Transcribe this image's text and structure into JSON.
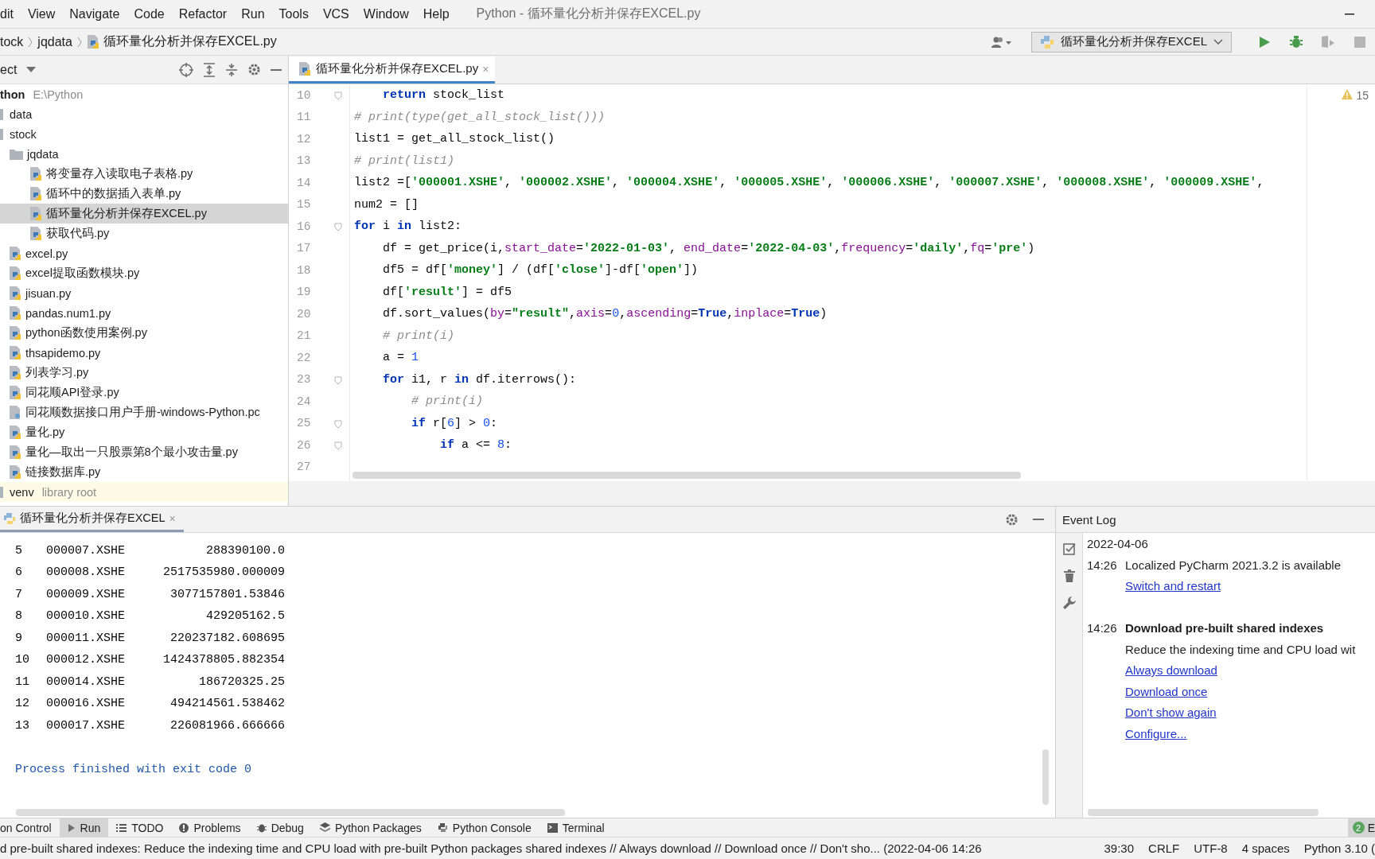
{
  "menu_items": [
    "dit",
    "View",
    "Navigate",
    "Code",
    "Refactor",
    "Run",
    "Tools",
    "VCS",
    "Window",
    "Help"
  ],
  "window": {
    "title": "Python - 循环量化分析并保存EXCEL.py"
  },
  "breadcrumbs": [
    {
      "label": "tock",
      "kind": "folder"
    },
    {
      "label": "jqdata",
      "kind": "folder"
    },
    {
      "label": "循环量化分析并保存EXCEL.py",
      "kind": "python"
    }
  ],
  "run_configuration": {
    "label": "循环量化分析并保存EXCEL"
  },
  "run_toolbar": [
    {
      "kind": "run",
      "disabled": false
    },
    {
      "kind": "debug",
      "disabled": false
    },
    {
      "kind": "coverage",
      "disabled": true
    },
    {
      "kind": "stop",
      "disabled": true
    }
  ],
  "project_panel": {
    "title": "ect",
    "tree": [
      {
        "label": "thon",
        "note": "E:\\Python",
        "kind": "root",
        "selected": false,
        "children": [
          {
            "label": "data",
            "kind": "folder",
            "selected": false
          },
          {
            "label": "stock",
            "kind": "folder",
            "selected": false,
            "children": [
              {
                "label": "jqdata",
                "kind": "folder",
                "selected": false,
                "children": [
                  {
                    "label": "将变量存入读取电子表格.py",
                    "kind": "python",
                    "selected": false
                  },
                  {
                    "label": "循环中的数据插入表单.py",
                    "kind": "python",
                    "selected": false
                  },
                  {
                    "label": "循环量化分析并保存EXCEL.py",
                    "kind": "python",
                    "selected": true
                  },
                  {
                    "label": "获取代码.py",
                    "kind": "python",
                    "selected": false
                  }
                ]
              },
              {
                "label": "excel.py",
                "kind": "python",
                "selected": false
              },
              {
                "label": "excel提取函数模块.py",
                "kind": "python",
                "selected": false
              },
              {
                "label": "jisuan.py",
                "kind": "python",
                "selected": false
              },
              {
                "label": "pandas.num1.py",
                "kind": "python",
                "selected": false
              },
              {
                "label": "python函数使用案例.py",
                "kind": "python",
                "selected": false
              },
              {
                "label": "thsapidemo.py",
                "kind": "python",
                "selected": false
              },
              {
                "label": "列表学习.py",
                "kind": "python",
                "selected": false
              },
              {
                "label": "同花顺API登录.py",
                "kind": "python",
                "selected": false
              },
              {
                "label": "同花顺数据接口用户手册-windows-Python.pc",
                "kind": "file",
                "selected": false
              },
              {
                "label": "量化.py",
                "kind": "python",
                "selected": false
              },
              {
                "label": "量化—取出一只股票第8个最小攻击量.py",
                "kind": "python",
                "selected": false
              },
              {
                "label": "链接数据库.py",
                "kind": "python",
                "selected": false
              }
            ]
          },
          {
            "label": "venv",
            "note": "library root",
            "kind": "folder",
            "selected": false
          }
        ]
      }
    ]
  },
  "editor": {
    "tabs": [
      {
        "label": "循环量化分析并保存EXCEL.py",
        "close": "×",
        "selected": true
      }
    ],
    "warnings": "15",
    "lines": [
      {
        "number": "10",
        "foldable": true,
        "tokens": [
          {
            "kind": "kw",
            "text": "    return"
          },
          {
            "kind": "plain",
            "text": " stock_list"
          }
        ]
      },
      {
        "number": "11",
        "foldable": false,
        "tokens": [
          {
            "kind": "cmt",
            "text": "# print(type(get_all_stock_list()))"
          }
        ]
      },
      {
        "number": "12",
        "foldable": false,
        "tokens": [
          {
            "kind": "plain",
            "text": "list1 = get_all_stock_list()"
          }
        ]
      },
      {
        "number": "13",
        "foldable": false,
        "tokens": [
          {
            "kind": "cmt",
            "text": "# print(list1)"
          }
        ]
      },
      {
        "number": "14",
        "foldable": false,
        "tokens": [
          {
            "kind": "plain",
            "text": "list2 =["
          },
          {
            "kind": "str",
            "text": "'000001.XSHE'"
          },
          {
            "kind": "plain",
            "text": ", "
          },
          {
            "kind": "str",
            "text": "'000002.XSHE'"
          },
          {
            "kind": "plain",
            "text": ", "
          },
          {
            "kind": "str",
            "text": "'000004.XSHE'"
          },
          {
            "kind": "plain",
            "text": ", "
          },
          {
            "kind": "str",
            "text": "'000005.XSHE'"
          },
          {
            "kind": "plain",
            "text": ", "
          },
          {
            "kind": "str",
            "text": "'000006.XSHE'"
          },
          {
            "kind": "plain",
            "text": ", "
          },
          {
            "kind": "str",
            "text": "'000007.XSHE'"
          },
          {
            "kind": "plain",
            "text": ", "
          },
          {
            "kind": "str",
            "text": "'000008.XSHE'"
          },
          {
            "kind": "plain",
            "text": ", "
          },
          {
            "kind": "str",
            "text": "'000009.XSHE'"
          },
          {
            "kind": "plain",
            "text": ","
          }
        ]
      },
      {
        "number": "15",
        "foldable": false,
        "tokens": [
          {
            "kind": "plain",
            "text": "num2 = []"
          }
        ]
      },
      {
        "number": "16",
        "foldable": true,
        "tokens": [
          {
            "kind": "kw",
            "text": "for"
          },
          {
            "kind": "plain",
            "text": " i "
          },
          {
            "kind": "kw",
            "text": "in"
          },
          {
            "kind": "plain",
            "text": " list2:"
          }
        ]
      },
      {
        "number": "17",
        "foldable": false,
        "tokens": [
          {
            "kind": "plain",
            "text": "    df = get_price(i,"
          },
          {
            "kind": "param",
            "text": "start_date"
          },
          {
            "kind": "plain",
            "text": "="
          },
          {
            "kind": "str",
            "text": "'2022-01-03'"
          },
          {
            "kind": "plain",
            "text": ", "
          },
          {
            "kind": "param",
            "text": "end_date"
          },
          {
            "kind": "plain",
            "text": "="
          },
          {
            "kind": "str",
            "text": "'2022-04-03'"
          },
          {
            "kind": "plain",
            "text": ","
          },
          {
            "kind": "param",
            "text": "frequency"
          },
          {
            "kind": "plain",
            "text": "="
          },
          {
            "kind": "str",
            "text": "'daily'"
          },
          {
            "kind": "plain",
            "text": ","
          },
          {
            "kind": "param",
            "text": "fq"
          },
          {
            "kind": "plain",
            "text": "="
          },
          {
            "kind": "str",
            "text": "'pre'"
          },
          {
            "kind": "plain",
            "text": ")"
          }
        ]
      },
      {
        "number": "18",
        "foldable": false,
        "tokens": [
          {
            "kind": "plain",
            "text": "    df5 = df["
          },
          {
            "kind": "str",
            "text": "'money'"
          },
          {
            "kind": "plain",
            "text": "] / (df["
          },
          {
            "kind": "str",
            "text": "'close'"
          },
          {
            "kind": "plain",
            "text": "]-df["
          },
          {
            "kind": "str",
            "text": "'open'"
          },
          {
            "kind": "plain",
            "text": "])"
          }
        ]
      },
      {
        "number": "19",
        "foldable": false,
        "tokens": [
          {
            "kind": "plain",
            "text": "    df["
          },
          {
            "kind": "str",
            "text": "'result'"
          },
          {
            "kind": "plain",
            "text": "] = df5"
          }
        ]
      },
      {
        "number": "20",
        "foldable": false,
        "tokens": [
          {
            "kind": "plain",
            "text": "    df.sort_values("
          },
          {
            "kind": "param",
            "text": "by"
          },
          {
            "kind": "plain",
            "text": "="
          },
          {
            "kind": "str",
            "text": "\"result\""
          },
          {
            "kind": "plain",
            "text": ","
          },
          {
            "kind": "param",
            "text": "axis"
          },
          {
            "kind": "plain",
            "text": "="
          },
          {
            "kind": "num",
            "text": "0"
          },
          {
            "kind": "plain",
            "text": ","
          },
          {
            "kind": "param",
            "text": "ascending"
          },
          {
            "kind": "plain",
            "text": "="
          },
          {
            "kind": "kw",
            "text": "True"
          },
          {
            "kind": "plain",
            "text": ","
          },
          {
            "kind": "param",
            "text": "inplace"
          },
          {
            "kind": "plain",
            "text": "="
          },
          {
            "kind": "kw",
            "text": "True"
          },
          {
            "kind": "plain",
            "text": ")"
          }
        ]
      },
      {
        "number": "21",
        "foldable": false,
        "tokens": [
          {
            "kind": "cmt",
            "text": "    # print(i)"
          }
        ]
      },
      {
        "number": "22",
        "foldable": false,
        "tokens": [
          {
            "kind": "plain",
            "text": "    a = "
          },
          {
            "kind": "num",
            "text": "1"
          }
        ]
      },
      {
        "number": "23",
        "foldable": true,
        "tokens": [
          {
            "kind": "kw",
            "text": "    for"
          },
          {
            "kind": "plain",
            "text": " i1, r "
          },
          {
            "kind": "kw",
            "text": "in"
          },
          {
            "kind": "plain",
            "text": " df.iterrows():"
          }
        ]
      },
      {
        "number": "24",
        "foldable": false,
        "tokens": [
          {
            "kind": "cmt",
            "text": "        # print(i)"
          }
        ]
      },
      {
        "number": "25",
        "foldable": true,
        "tokens": [
          {
            "kind": "kw",
            "text": "        if"
          },
          {
            "kind": "plain",
            "text": " r["
          },
          {
            "kind": "num",
            "text": "6"
          },
          {
            "kind": "plain",
            "text": "] > "
          },
          {
            "kind": "num",
            "text": "0"
          },
          {
            "kind": "plain",
            "text": ":"
          }
        ]
      },
      {
        "number": "26",
        "foldable": true,
        "tokens": [
          {
            "kind": "kw",
            "text": "            if"
          },
          {
            "kind": "plain",
            "text": " a <= "
          },
          {
            "kind": "num",
            "text": "8"
          },
          {
            "kind": "plain",
            "text": ":"
          }
        ]
      },
      {
        "number": "27",
        "foldable": false
      }
    ]
  },
  "run_panel": {
    "tab": {
      "label": "循环量化分析并保存EXCEL",
      "close": "×",
      "selected": true
    },
    "output": [
      {
        "index": "5",
        "symbol": "000007.XSHE",
        "value": "288390100.0"
      },
      {
        "index": "6",
        "symbol": "000008.XSHE",
        "value": "2517535980.000009"
      },
      {
        "index": "7",
        "symbol": "000009.XSHE",
        "value": "3077157801.53846"
      },
      {
        "index": "8",
        "symbol": "000010.XSHE",
        "value": "429205162.5"
      },
      {
        "index": "9",
        "symbol": "000011.XSHE",
        "value": "220237182.608695"
      },
      {
        "index": "10",
        "symbol": "000012.XSHE",
        "value": "1424378805.882354"
      },
      {
        "index": "11",
        "symbol": "000014.XSHE",
        "value": "186720325.25"
      },
      {
        "index": "12",
        "symbol": "000016.XSHE",
        "value": "494214561.538462"
      },
      {
        "index": "13",
        "symbol": "000017.XSHE",
        "value": "226081966.666666"
      }
    ],
    "exit_message": "Process finished with exit code 0"
  },
  "event_log": {
    "title": "Event Log",
    "date": "2022-04-06",
    "events": [
      {
        "time": "14:26",
        "title": "Localized PyCharm 2021.3.2 is available",
        "bold": false,
        "links": [
          "Switch and restart"
        ]
      },
      {
        "time": "14:26",
        "title": "Download pre-built shared indexes",
        "bold": true,
        "text": "Reduce the indexing time and CPU load wit",
        "links": [
          "Always download",
          "Download once",
          "Don't show again",
          "Configure..."
        ]
      }
    ]
  },
  "tool_windows": [
    {
      "label": "on Control",
      "kind": "vcs",
      "selected": false
    },
    {
      "label": "Run",
      "kind": "run",
      "selected": true
    },
    {
      "label": "TODO",
      "kind": "todo",
      "selected": false
    },
    {
      "label": "Problems",
      "kind": "problems",
      "selected": false
    },
    {
      "label": "Debug",
      "kind": "debug",
      "selected": false
    },
    {
      "label": "Python Packages",
      "kind": "packages",
      "selected": false
    },
    {
      "label": "Python Console",
      "kind": "console",
      "selected": false
    },
    {
      "label": "Terminal",
      "kind": "terminal",
      "selected": false
    }
  ],
  "event_log_button": {
    "badge": "2",
    "label": "E"
  },
  "status_bar": {
    "message": "d pre-built shared indexes: Reduce the indexing time and CPU load with pre-built Python packages shared indexes // Always download // Download once // Don't sho... (2022-04-06 14:26",
    "items": [
      "39:30",
      "CRLF",
      "UTF-8",
      "4 spaces",
      "Python 3.10 ("
    ]
  }
}
